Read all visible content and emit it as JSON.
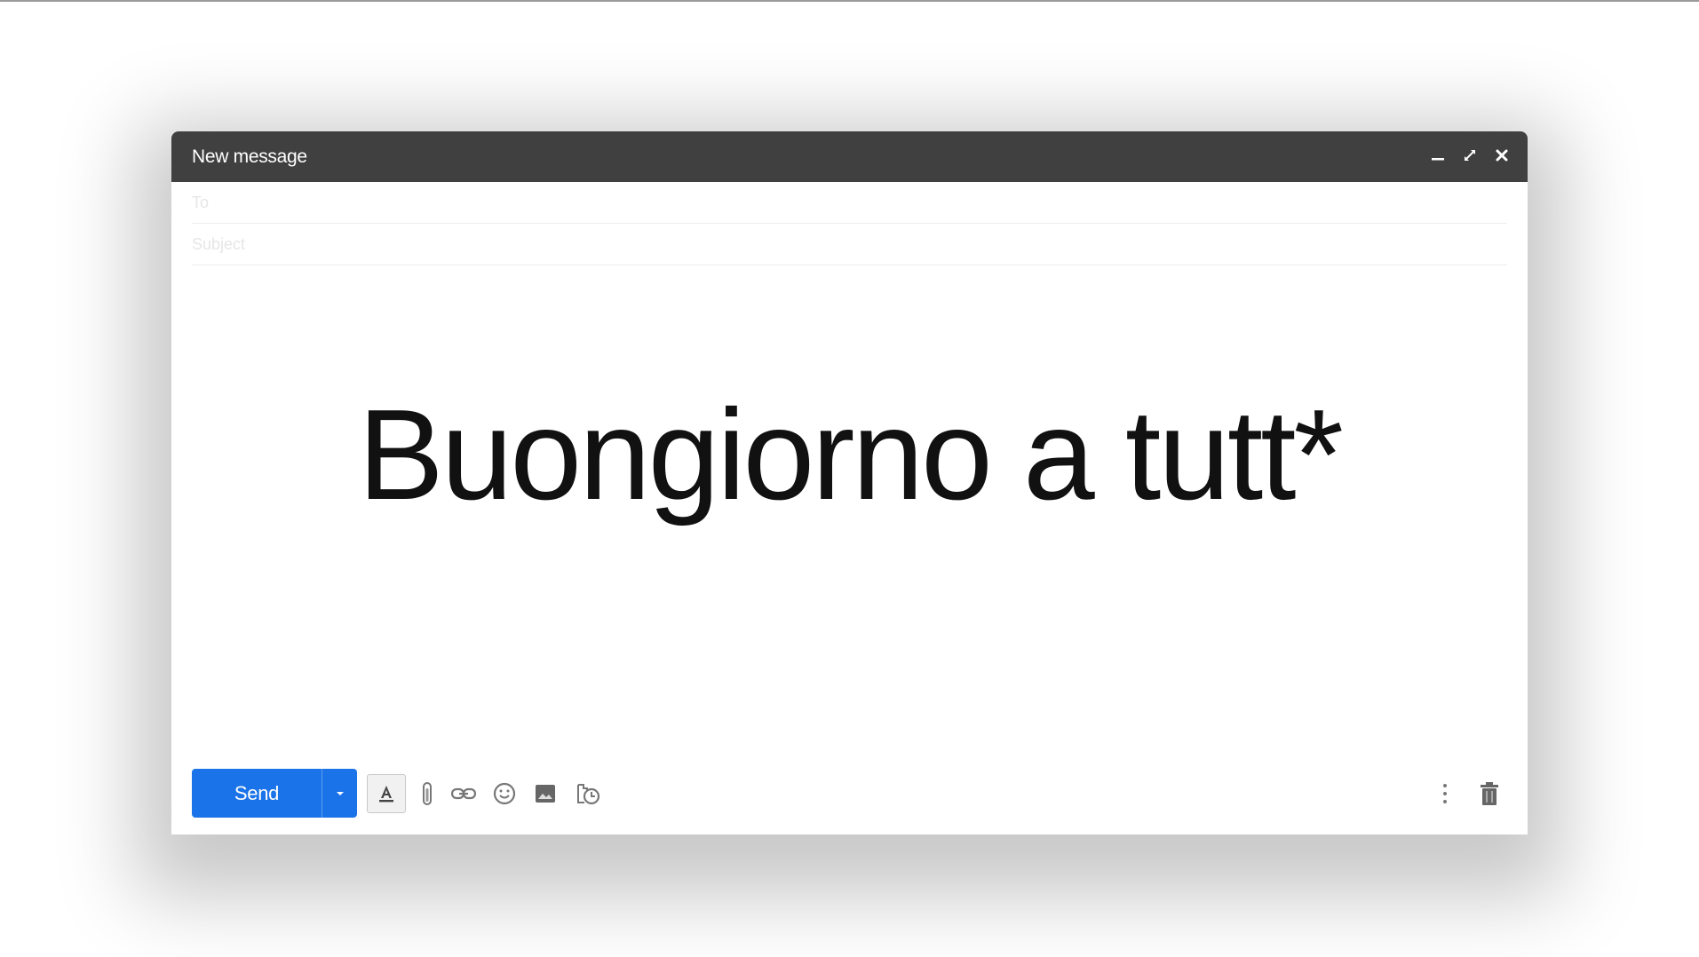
{
  "window": {
    "title": "New message",
    "controls": {
      "minimize_icon": "minimize-icon",
      "fullscreen_icon": "expand-icon",
      "close_icon": "close-icon"
    }
  },
  "fields": {
    "to_placeholder": "To",
    "subject_placeholder": "Subject"
  },
  "body": {
    "text": "Buongiorno a tutt*"
  },
  "toolbar": {
    "send_label": "Send",
    "icons": [
      "formatting-icon",
      "attach-icon",
      "link-icon",
      "emoji-icon",
      "photo-icon",
      "schedule-icon",
      "more-options-icon",
      "trash-icon"
    ]
  },
  "colors": {
    "titlebar": "#404040",
    "send_button": "#1a73e8",
    "icon_gray": "#6b6b6b"
  }
}
